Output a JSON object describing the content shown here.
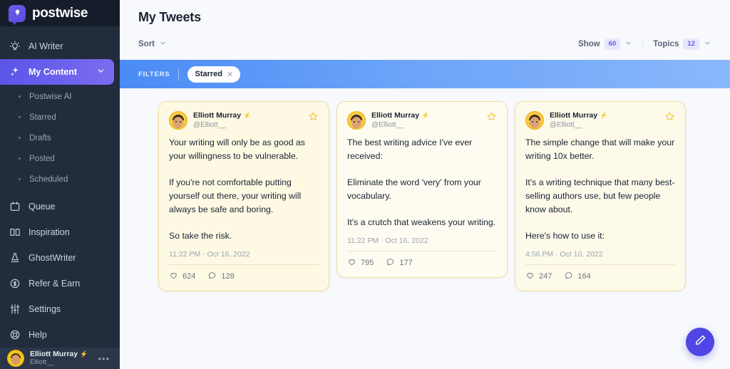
{
  "brand": {
    "name": "postwise",
    "logo_icon": "lightbulb-speech-bubble-icon"
  },
  "sidebar": {
    "items": [
      {
        "label": "AI Writer",
        "icon": "lightbulb-icon",
        "active": false
      },
      {
        "label": "My Content",
        "icon": "sparkles-icon",
        "active": true,
        "chevron": "chevron-down-icon"
      }
    ],
    "subitems": [
      {
        "label": "Postwise AI"
      },
      {
        "label": "Starred"
      },
      {
        "label": "Drafts"
      },
      {
        "label": "Posted"
      },
      {
        "label": "Scheduled"
      }
    ],
    "items_lower": [
      {
        "label": "Queue",
        "icon": "calendar-icon"
      },
      {
        "label": "Inspiration",
        "icon": "book-open-icon"
      },
      {
        "label": "GhostWriter",
        "icon": "ghost-icon"
      },
      {
        "label": "Refer & Earn",
        "icon": "dollar-circle-icon"
      },
      {
        "label": "Settings",
        "icon": "sliders-icon"
      },
      {
        "label": "Help",
        "icon": "lifebuoy-icon"
      }
    ],
    "profile": {
      "name": "Elliott Murray",
      "bolt": "⚡",
      "handle": "Elliott__",
      "menu_icon": "ellipsis-icon",
      "avatar": "user-avatar"
    }
  },
  "header": {
    "title": "My Tweets",
    "sort": {
      "label": "Sort",
      "chevron": "chevron-down-icon"
    },
    "show": {
      "label": "Show",
      "value": "60",
      "chevron": "chevron-down-icon"
    },
    "topics": {
      "label": "Topics",
      "value": "12",
      "chevron": "chevron-down-icon"
    }
  },
  "filters": {
    "label": "FILTERS",
    "chips": [
      {
        "label": "Starred",
        "remove_icon": "close-icon"
      }
    ]
  },
  "cards": [
    {
      "author": "Elliott Murray",
      "bolt": "⚡",
      "handle": "@Elliott__",
      "starred_icon": "star-icon",
      "text": "Your writing will only be as good as your willingness to be vulnerable.\n\nIf you're not comfortable putting yourself out there, your writing will always be safe and boring.\n\nSo take the risk.",
      "timestamp": "11:22 PM · Oct 16, 2022",
      "likes": "624",
      "replies": "128"
    },
    {
      "author": "Elliott Murray",
      "bolt": "⚡",
      "handle": "@Elliott__",
      "starred_icon": "star-icon",
      "text": "The best writing advice I've ever received:\n\nEliminate the word 'very' from your vocabulary.\n\nIt's a crutch that weakens your writing.",
      "timestamp": "11:22 PM · Oct 16, 2022",
      "likes": "795",
      "replies": "177"
    },
    {
      "author": "Elliott Murray",
      "bolt": "⚡",
      "handle": "@Elliott__",
      "starred_icon": "star-icon",
      "text": "The simple change that will make your writing 10x better.\n\nIt's a writing technique that many best-selling authors use, but few people know about.\n\nHere's how to use it:",
      "timestamp": "4:56 PM · Oct 10, 2022",
      "likes": "247",
      "replies": "164"
    }
  ],
  "fab": {
    "icon": "pencil-icon"
  },
  "colors": {
    "sidebar_bg": "#222c3d",
    "sidebar_top": "#151d2b",
    "accent_purple": "#5b54e8",
    "filter_blue_start": "#4a8bf5",
    "filter_blue_end": "#89b8fb",
    "card_bg": "#fdf9e3",
    "card_border": "#f0dfa0",
    "badge_bg": "#e8e6fd",
    "badge_text": "#6c5ce7",
    "star_gold": "#f0c93e",
    "fab_bg": "#4f46e5"
  }
}
